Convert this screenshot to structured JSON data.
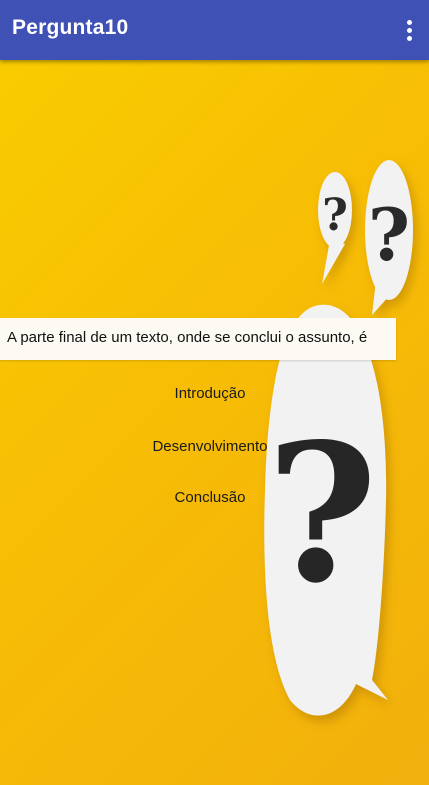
{
  "app_bar": {
    "title": "Pergunta10",
    "menu_icon": "more-vert-icon"
  },
  "question": {
    "text": "A parte final de um texto, onde se conclui o assunto, é"
  },
  "options": [
    {
      "label": "Introdução"
    },
    {
      "label": "Desenvolvimento"
    },
    {
      "label": "Conclusão"
    }
  ],
  "colors": {
    "app_bar": "#3f51b5",
    "background": "#f7bd05",
    "bubble": "#f2f2f2"
  }
}
